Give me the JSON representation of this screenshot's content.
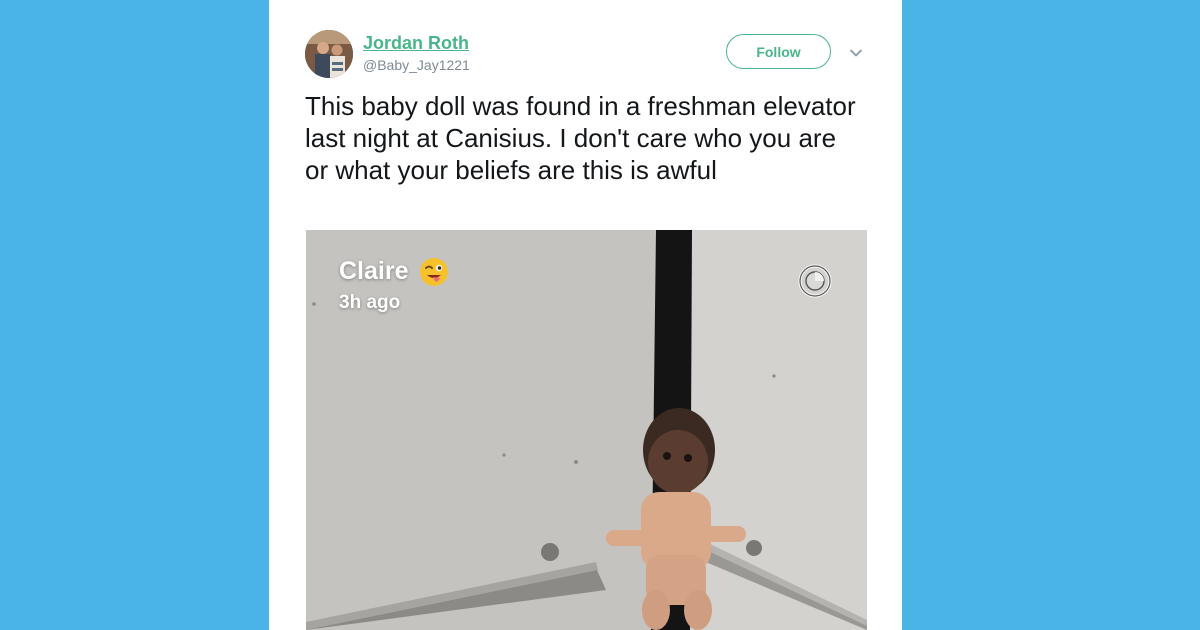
{
  "tweet": {
    "author": {
      "name": "Jordan Roth",
      "handle": "@Baby_Jay1221",
      "avatar_icon": "profile-avatar"
    },
    "follow_label": "Follow",
    "more_icon": "chevron-down-icon",
    "text": "This baby doll was found in a freshman elevator last night at Canisius. I don't care who you are or what your beliefs are this is awful",
    "media": {
      "snap_name": "Claire",
      "snap_emoji_icon": "winking-tongue-emoji",
      "snap_time": "3h ago",
      "timer_icon": "snap-timer-icon"
    }
  },
  "colors": {
    "page_background": "#4ab3e8",
    "card_background": "#ffffff",
    "accent": "#48b68a",
    "text": "#14171a",
    "secondary_text": "#7f8a93"
  }
}
